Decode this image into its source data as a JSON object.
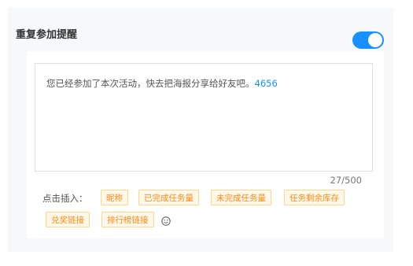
{
  "section": {
    "title": "重复参加提醒",
    "toggle_on": true,
    "accent_color": "#1890ff"
  },
  "editor": {
    "message": "您已经参加了本次活动，快去把海报分享给好友吧。",
    "message_suffix": "4656",
    "counter": "27/500"
  },
  "insert": {
    "label": "点击插入：",
    "tags": [
      "昵称",
      "已完成任务量",
      "未完成任务量",
      "任务剩余库存",
      "兑奖链接",
      "排行榜链接"
    ],
    "tag_color": "#fa8c16",
    "emoji_icon": "smile-icon"
  }
}
